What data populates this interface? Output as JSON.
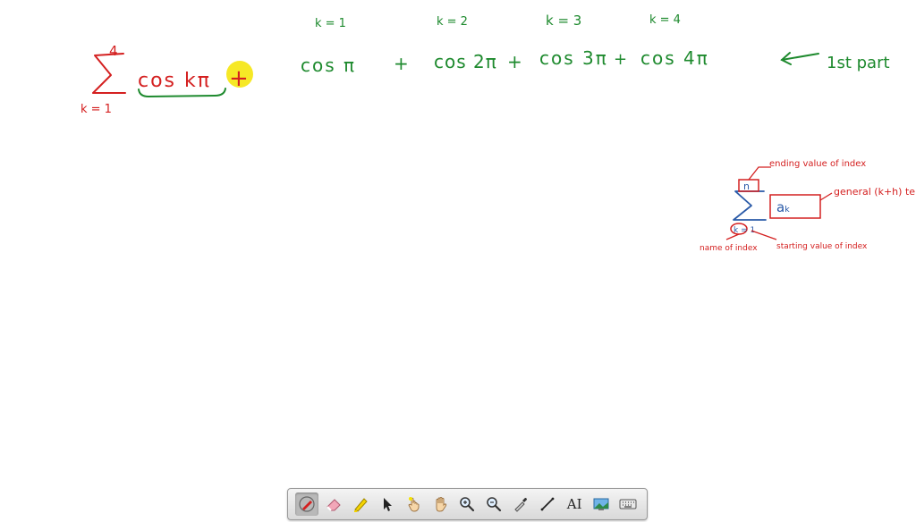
{
  "whiteboard": {
    "summation": {
      "upper": "4",
      "lower": "k = 1",
      "term": "cos kπ",
      "plus": "+"
    },
    "k_labels": [
      "k = 1",
      "k = 2",
      "k = 3",
      "k = 4"
    ],
    "expansion": {
      "t1": "cos π",
      "p1": "+",
      "t2": "cos 2π",
      "p2": "+",
      "t3": "cos 3π",
      "p3": "+",
      "t4": "cos 4π"
    },
    "annotation": "1st part",
    "diagram": {
      "upper": "n",
      "term": "aₖ",
      "lower": "k = 1",
      "ending_label": "ending value of index",
      "general_label": "general (k+h) term of the s",
      "name_label": "name of index",
      "starting_label": "starting value of index"
    }
  },
  "toolbar": {
    "tools": [
      {
        "name": "pen-tool",
        "icon": "pen-icon",
        "active": true
      },
      {
        "name": "eraser-tool",
        "icon": "eraser-icon",
        "active": false
      },
      {
        "name": "highlighter-tool",
        "icon": "highlighter-icon",
        "active": false
      },
      {
        "name": "select-tool",
        "icon": "cursor-arrow-icon",
        "active": false
      },
      {
        "name": "laser-tool",
        "icon": "laser-hand-icon",
        "active": false
      },
      {
        "name": "pan-tool",
        "icon": "hand-icon",
        "active": false
      },
      {
        "name": "zoom-in-tool",
        "icon": "zoom-in-icon",
        "active": false
      },
      {
        "name": "zoom-out-tool",
        "icon": "zoom-out-icon",
        "active": false
      },
      {
        "name": "eyedropper-tool",
        "icon": "eyedropper-icon",
        "active": false
      },
      {
        "name": "line-tool",
        "icon": "line-icon",
        "active": false
      },
      {
        "name": "text-tool",
        "icon": "text-icon",
        "active": false
      },
      {
        "name": "image-tool",
        "icon": "image-icon",
        "active": false
      },
      {
        "name": "keyboard-tool",
        "icon": "keyboard-icon",
        "active": false
      }
    ],
    "text_tool_label": "AI"
  },
  "colors": {
    "green_ink": "#1e8a2e",
    "red_ink": "#d42020",
    "blue_ink": "#2a5aa8",
    "highlight": "#f5e400"
  }
}
